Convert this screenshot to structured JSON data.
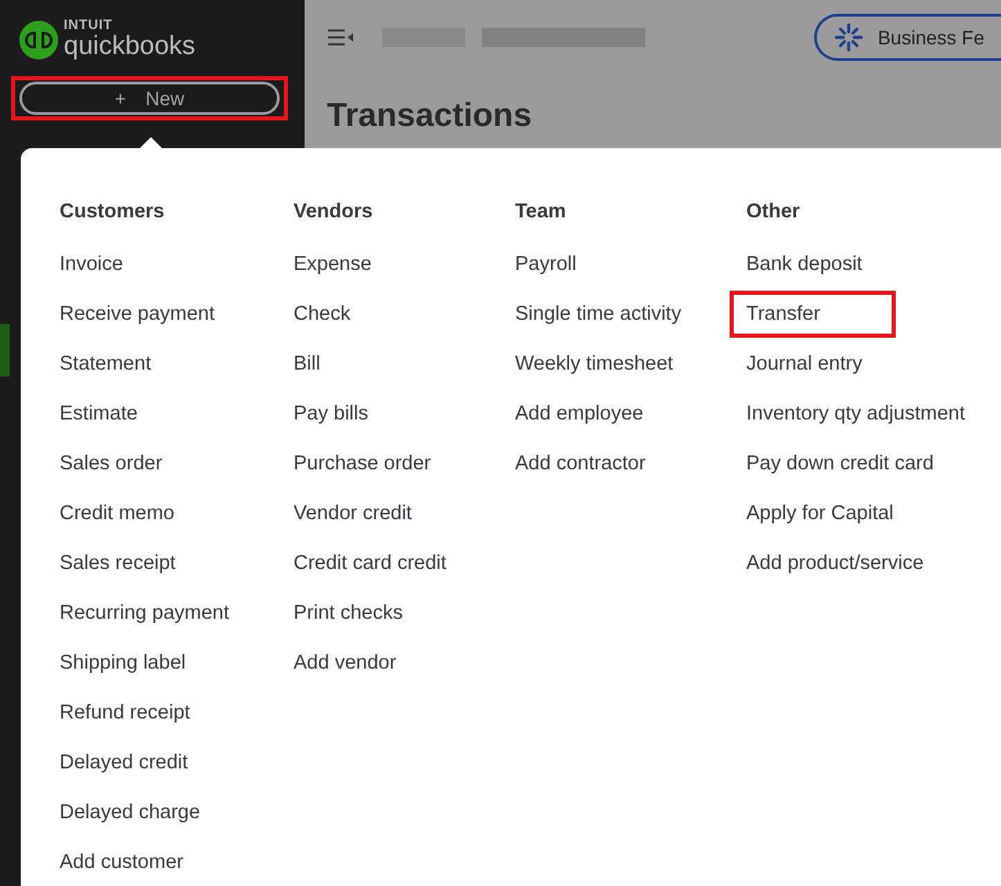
{
  "sidebar": {
    "logo": {
      "brand": "INTUIT",
      "product": "quickbooks"
    },
    "new_button": {
      "icon": "+",
      "label": "New",
      "highlighted": true
    }
  },
  "header": {
    "business_feed_button": {
      "label": "Business Fe"
    }
  },
  "page_title": "Transactions",
  "new_menu": {
    "columns": [
      {
        "heading": "Customers",
        "items": [
          {
            "label": "Invoice",
            "highlighted": false
          },
          {
            "label": "Receive payment",
            "highlighted": false
          },
          {
            "label": "Statement",
            "highlighted": false
          },
          {
            "label": "Estimate",
            "highlighted": false
          },
          {
            "label": "Sales order",
            "highlighted": false
          },
          {
            "label": "Credit memo",
            "highlighted": false
          },
          {
            "label": "Sales receipt",
            "highlighted": false
          },
          {
            "label": "Recurring payment",
            "highlighted": false
          },
          {
            "label": "Shipping label",
            "highlighted": false
          },
          {
            "label": "Refund receipt",
            "highlighted": false
          },
          {
            "label": "Delayed credit",
            "highlighted": false
          },
          {
            "label": "Delayed charge",
            "highlighted": false
          },
          {
            "label": "Add customer",
            "highlighted": false
          }
        ]
      },
      {
        "heading": "Vendors",
        "items": [
          {
            "label": "Expense",
            "highlighted": false
          },
          {
            "label": "Check",
            "highlighted": false
          },
          {
            "label": "Bill",
            "highlighted": false
          },
          {
            "label": "Pay bills",
            "highlighted": false
          },
          {
            "label": "Purchase order",
            "highlighted": false
          },
          {
            "label": "Vendor credit",
            "highlighted": false
          },
          {
            "label": "Credit card credit",
            "highlighted": false
          },
          {
            "label": "Print checks",
            "highlighted": false
          },
          {
            "label": "Add vendor",
            "highlighted": false
          }
        ]
      },
      {
        "heading": "Team",
        "items": [
          {
            "label": "Payroll",
            "highlighted": false
          },
          {
            "label": "Single time activity",
            "highlighted": false
          },
          {
            "label": "Weekly timesheet",
            "highlighted": false
          },
          {
            "label": "Add employee",
            "highlighted": false
          },
          {
            "label": "Add contractor",
            "highlighted": false
          }
        ]
      },
      {
        "heading": "Other",
        "items": [
          {
            "label": "Bank deposit",
            "highlighted": false
          },
          {
            "label": "Transfer",
            "highlighted": true
          },
          {
            "label": "Journal entry",
            "highlighted": false
          },
          {
            "label": "Inventory qty adjustment",
            "highlighted": false
          },
          {
            "label": "Pay down credit card",
            "highlighted": false
          },
          {
            "label": "Apply for Capital",
            "highlighted": false
          },
          {
            "label": "Add product/service",
            "highlighted": false
          }
        ]
      }
    ]
  }
}
